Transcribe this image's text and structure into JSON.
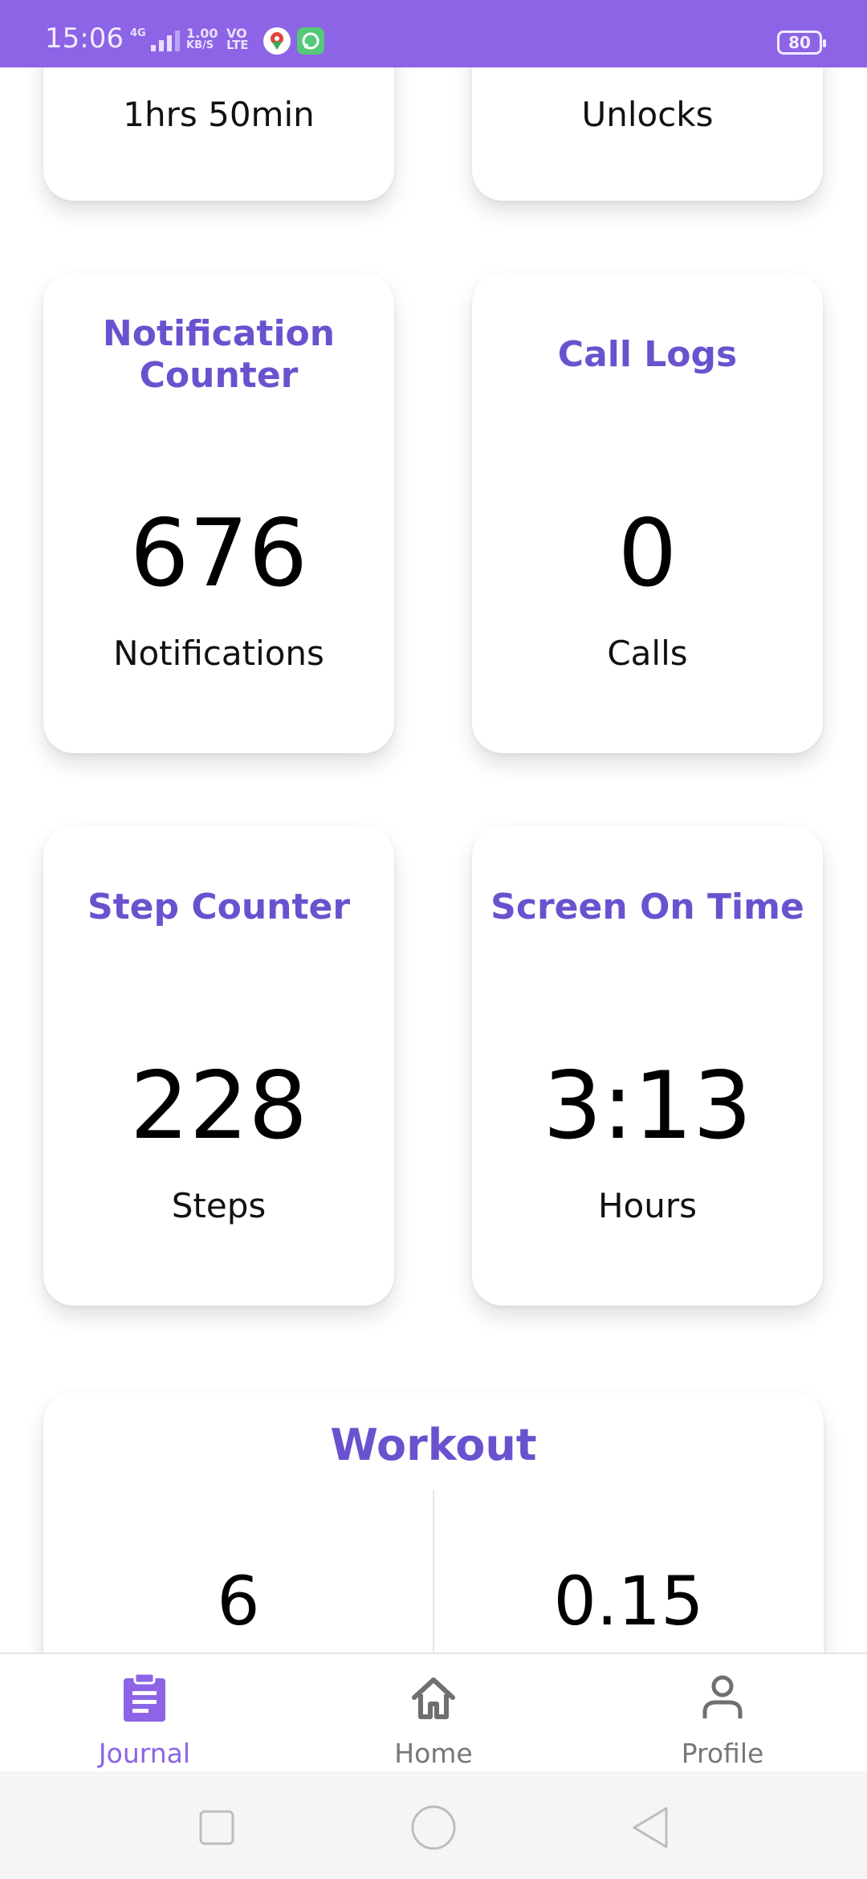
{
  "status_bar": {
    "time": "15:06",
    "network_type": "4G",
    "speed_value": "1.00",
    "speed_unit": "KB/S",
    "volte_top": "VO",
    "volte_bottom": "LTE",
    "battery": "80",
    "background_color": "#8c64e5"
  },
  "top_cards": [
    {
      "text": "1hrs 50min"
    },
    {
      "text": "Unlocks"
    }
  ],
  "cards": [
    {
      "title_line1": "Notification",
      "title_line2": "Counter",
      "value": "676",
      "unit": "Notifications"
    },
    {
      "title": "Call Logs",
      "value": "0",
      "unit": "Calls"
    },
    {
      "title": "Step Counter",
      "value": "228",
      "unit": "Steps"
    },
    {
      "title": "Screen On Time",
      "value": "3:13",
      "unit": "Hours"
    }
  ],
  "workout": {
    "title": "Workout",
    "left_value": "6",
    "right_value": "0.15"
  },
  "bottom_nav": {
    "items": [
      {
        "label": "Journal",
        "icon": "clipboard-icon",
        "active": true
      },
      {
        "label": "Home",
        "icon": "home-icon",
        "active": false
      },
      {
        "label": "Profile",
        "icon": "person-icon",
        "active": false
      }
    ]
  },
  "colors": {
    "accent": "#8c64e5",
    "title": "#6a52cf",
    "inactive": "#777777"
  },
  "system_nav": {
    "icons": [
      "square-icon",
      "circle-icon",
      "back-triangle-icon"
    ]
  }
}
